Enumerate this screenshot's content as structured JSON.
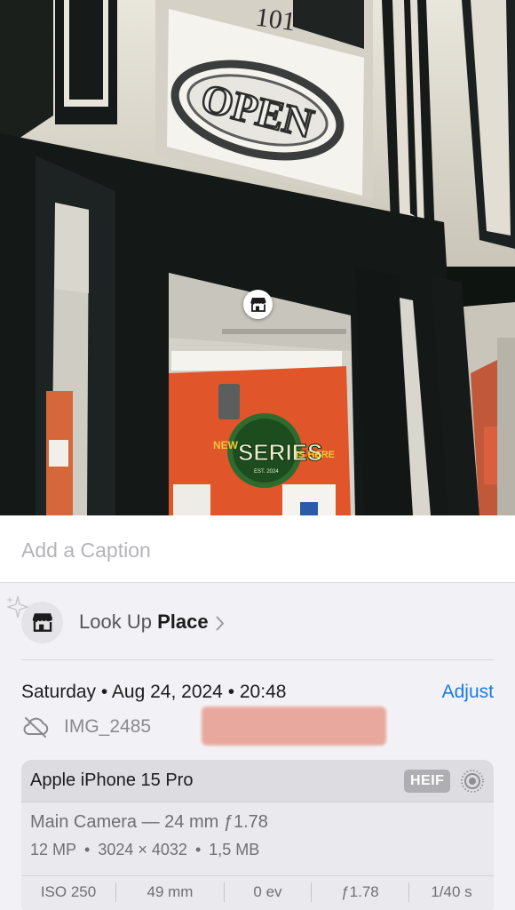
{
  "photo": {
    "sign_text": "OPEN",
    "door_number": "101",
    "poster": {
      "new": "NEW",
      "series": "SERIES",
      "is_here": "IS HERE",
      "est": "EST. 2024"
    }
  },
  "caption": {
    "placeholder": "Add a Caption",
    "value": ""
  },
  "lookup": {
    "prefix": "Look Up",
    "subject": "Place"
  },
  "meta": {
    "date": "Saturday • Aug 24, 2024 • 20:48",
    "adjust_label": "Adjust",
    "filename": "IMG_2485"
  },
  "exif": {
    "device": "Apple iPhone 15 Pro",
    "format": "HEIF",
    "lens": "Main Camera — 24 mm ƒ1.78",
    "megapixels": "12 MP",
    "dimensions": "3024 × 4032",
    "size": "1,5 MB",
    "separator": "•",
    "stats": [
      "ISO 250",
      "49 mm",
      "0 ev",
      "ƒ1.78",
      "1/40 s"
    ]
  },
  "colors": {
    "accent": "#1a7ae0",
    "poster_orange": "#e0552a",
    "poster_green": "#2f6b2e"
  }
}
